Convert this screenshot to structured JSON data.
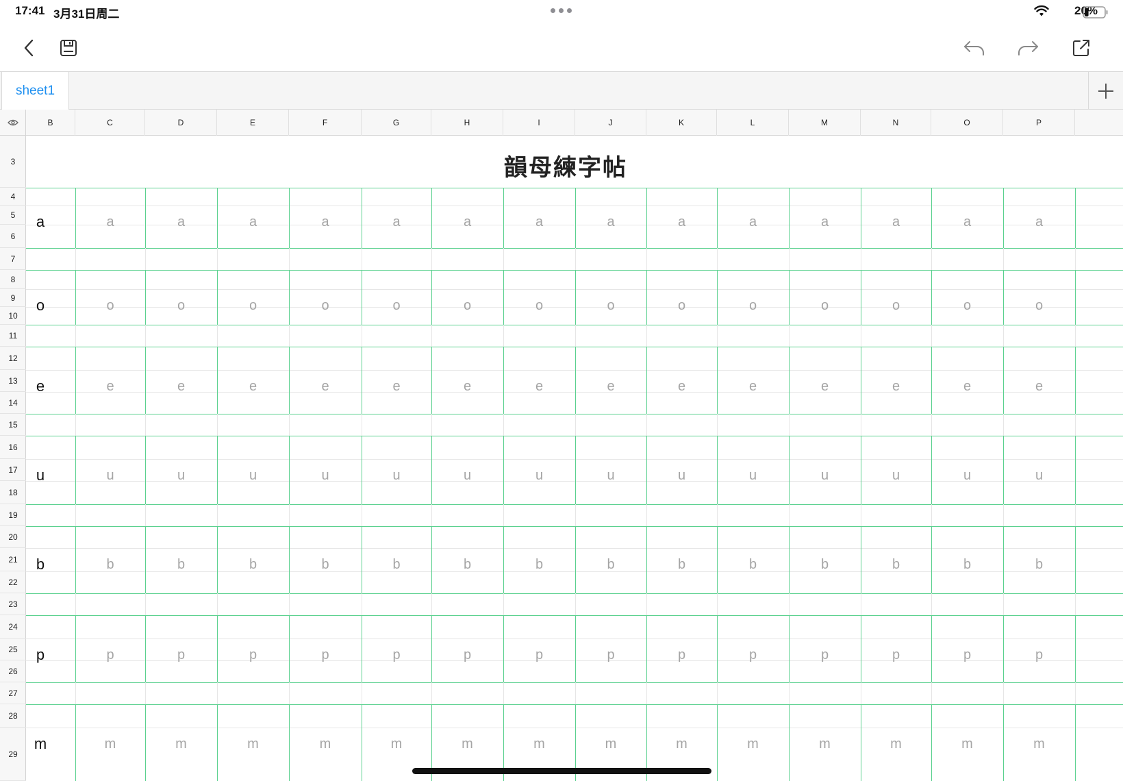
{
  "status_bar": {
    "time": "17:41",
    "date": "3月31日周二",
    "battery_percent": "20%",
    "battery_level": 0.2
  },
  "toolbar": {
    "back_icon": "chevron-left-icon",
    "save_icon": "floppy-disk-icon",
    "undo_icon": "undo-icon",
    "redo_icon": "redo-icon",
    "share_icon": "share-icon"
  },
  "tabs": {
    "active_tab": "sheet1",
    "add_icon": "plus-icon",
    "active_color": "#1d8ff0"
  },
  "sheet": {
    "title": "韻母練字帖",
    "columns": [
      "B",
      "C",
      "D",
      "E",
      "F",
      "G",
      "H",
      "I",
      "J",
      "K",
      "L",
      "M",
      "N",
      "O",
      "P"
    ],
    "rows": [
      "3",
      "4",
      "5",
      "6",
      "7",
      "8",
      "9",
      "10",
      "11",
      "12",
      "13",
      "14",
      "15",
      "16",
      "17",
      "18",
      "19",
      "20",
      "21",
      "22",
      "23",
      "24",
      "25",
      "26",
      "27",
      "28",
      "29"
    ],
    "practice_letters": [
      "a",
      "o",
      "e",
      "u",
      "b",
      "p",
      "m"
    ],
    "grid_color": "#5bd18f",
    "trace_color": "#a5a5a5"
  }
}
